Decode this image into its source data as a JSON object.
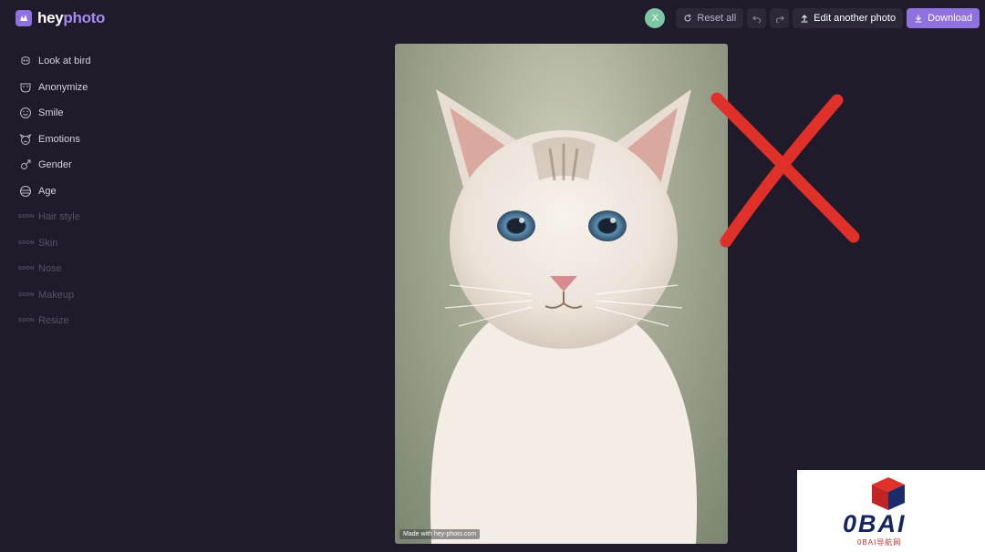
{
  "brand": {
    "name_part1": "hey",
    "name_part2": "photo"
  },
  "topbar": {
    "avatar_initial": "X",
    "reset_label": "Reset all",
    "edit_label": "Edit another photo",
    "download_label": "Download"
  },
  "sidebar": {
    "items": [
      {
        "label": "Look at bird",
        "icon": "bird-icon"
      },
      {
        "label": "Anonymize",
        "icon": "mask-icon"
      },
      {
        "label": "Smile",
        "icon": "smile-icon"
      },
      {
        "label": "Emotions",
        "icon": "emotions-icon"
      },
      {
        "label": "Gender",
        "icon": "gender-icon"
      },
      {
        "label": "Age",
        "icon": "age-icon"
      }
    ],
    "soon_badge": "SOON",
    "soon_items": [
      "Hair style",
      "Skin",
      "Nose",
      "Makeup",
      "Resize"
    ]
  },
  "photo": {
    "watermark": "Made with hey-photo.com",
    "subject": "cat portrait"
  },
  "overlay_badge": {
    "title": "0BAI",
    "subtitle": "0BAI导航网"
  },
  "colors": {
    "background": "#1f1b2b",
    "accent": "#8f72e0",
    "avatar": "#7fc7a4",
    "red_x": "#e0302a"
  }
}
